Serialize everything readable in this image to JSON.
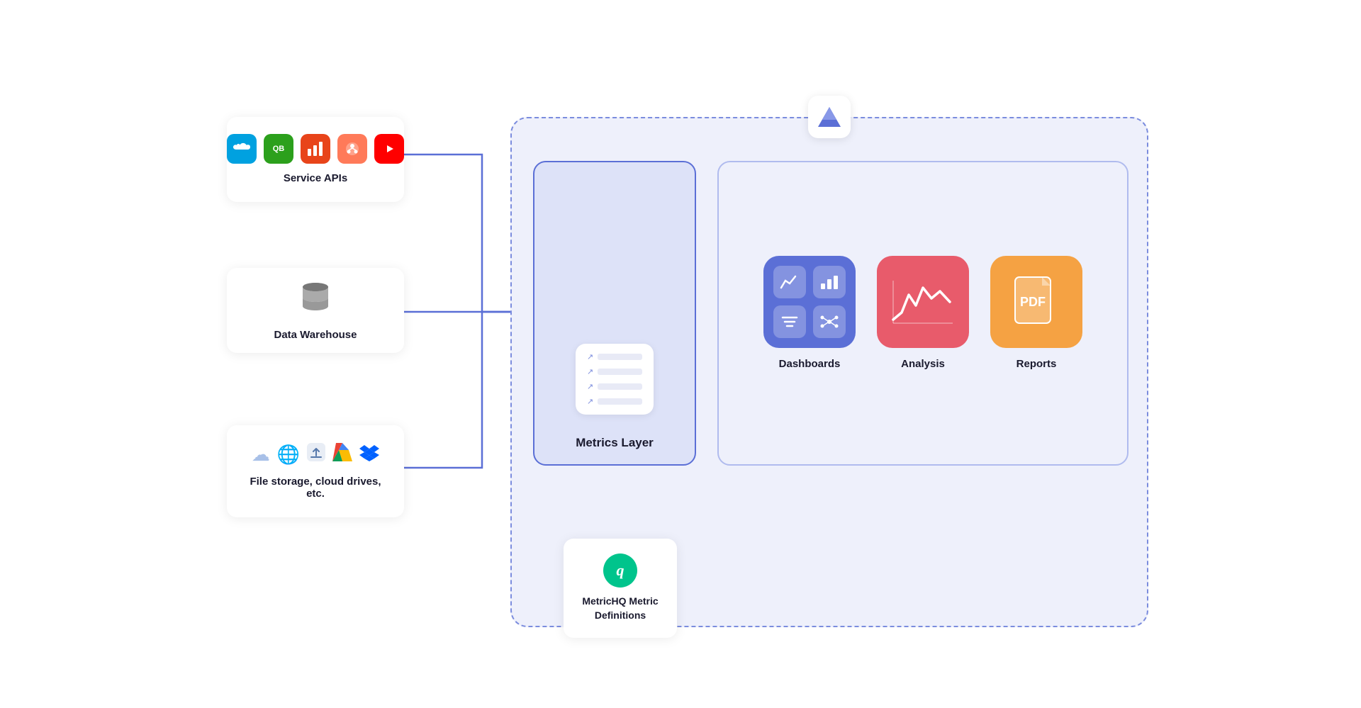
{
  "sources": {
    "service_apis": {
      "label": "Service APIs",
      "icons": [
        "salesforce",
        "quickbooks",
        "charts",
        "hubspot",
        "youtube"
      ]
    },
    "data_warehouse": {
      "label": "Data Warehouse",
      "icons": [
        "database"
      ]
    },
    "file_storage": {
      "label": "File storage, cloud drives, etc.",
      "icons": [
        "cloud",
        "globe",
        "upload",
        "gdrive",
        "dropbox"
      ]
    }
  },
  "metrichq": {
    "label": "MetricHQ\nMetric Definitions"
  },
  "metrics_layer": {
    "label": "Metrics Layer"
  },
  "outputs": {
    "dashboards": {
      "label": "Dashboards"
    },
    "analysis": {
      "label": "Analysis"
    },
    "reports": {
      "label": "Reports"
    }
  },
  "brand": {
    "primary": "#5b6fd6",
    "light_bg": "#eef0fb",
    "dashed_border": "#7b8cde"
  }
}
